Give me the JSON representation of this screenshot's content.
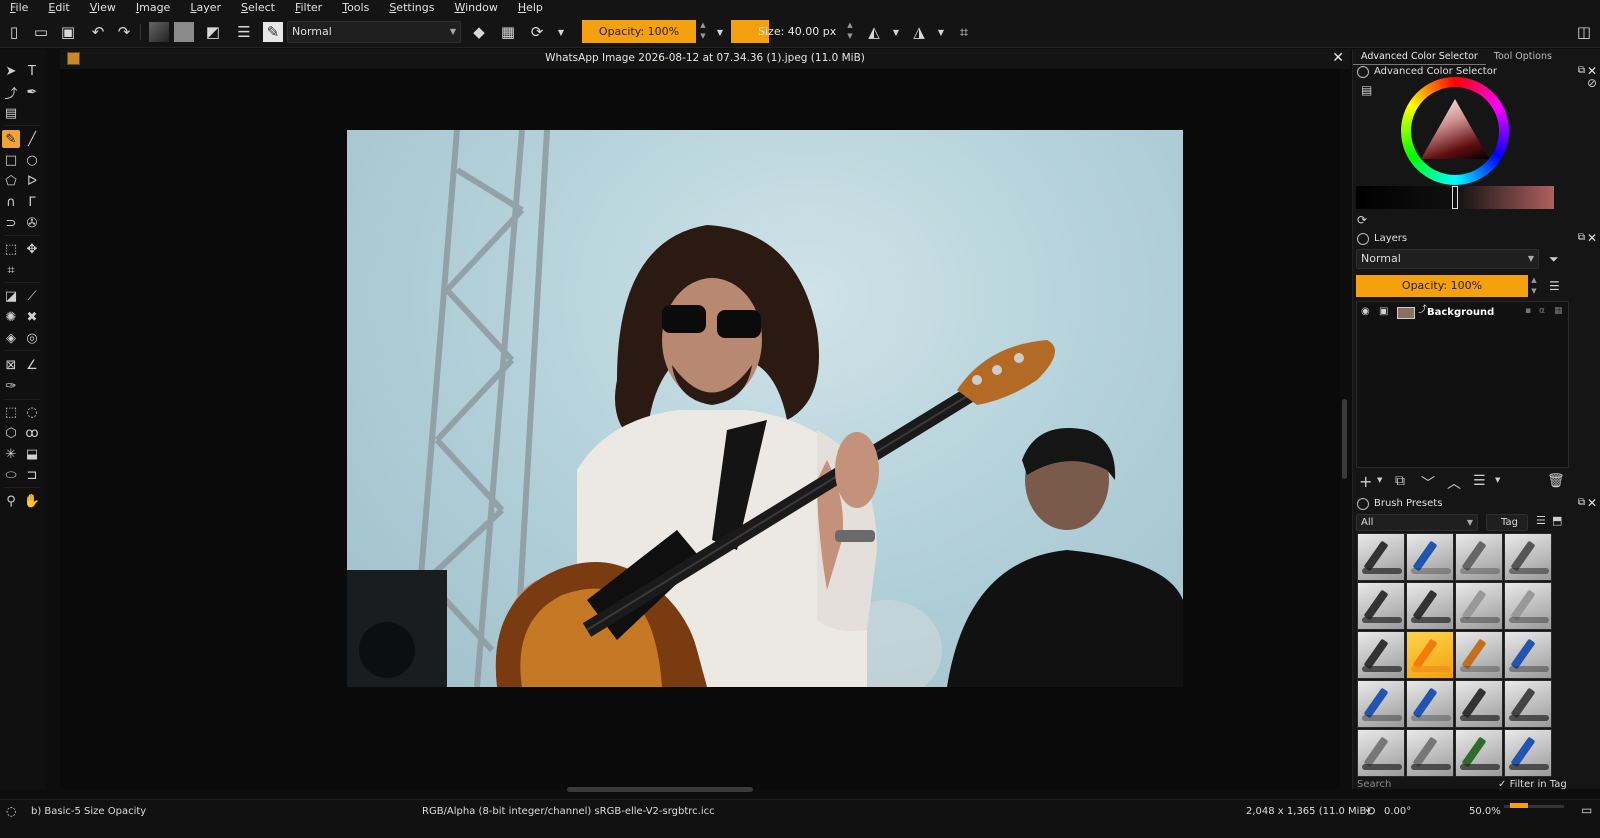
{
  "menu": [
    "File",
    "Edit",
    "View",
    "Image",
    "Layer",
    "Select",
    "Filter",
    "Tools",
    "Settings",
    "Window",
    "Help"
  ],
  "toolbar": {
    "blend_mode": "Normal",
    "opacity_label": "Opacity: 100%",
    "size_label": "Size: 40.00 px"
  },
  "document": {
    "title": "WhatsApp Image 2026-08-12 at 07.34.36 (1).jpeg (11.0 MiB)"
  },
  "dock": {
    "tabs": [
      "Advanced Color Selector",
      "Tool Options"
    ],
    "color_selector_title": "Advanced Color Selector",
    "layers_title": "Layers",
    "layer_blend_mode": "Normal",
    "layer_opacity": "Opacity: 100%",
    "layers": [
      {
        "name": "Background"
      }
    ],
    "brush_presets_title": "Brush Presets",
    "brush_filter": "All",
    "tag_label": "Tag",
    "search_placeholder": "Search",
    "filter_in_tag": "Filter in Tag"
  },
  "status": {
    "brush": "b) Basic-5 Size Opacity",
    "color_space": "RGB/Alpha (8-bit integer/channel)  sRGB-elle-V2-srgbtrc.icc",
    "dimensions": "2,048 x 1,365 (11.0 MiB)",
    "rotation": "0.00°",
    "zoom": "50.0%"
  },
  "colors": {
    "accent": "#f5a10d",
    "background": "#0d0d0d",
    "panel": "#151515"
  }
}
